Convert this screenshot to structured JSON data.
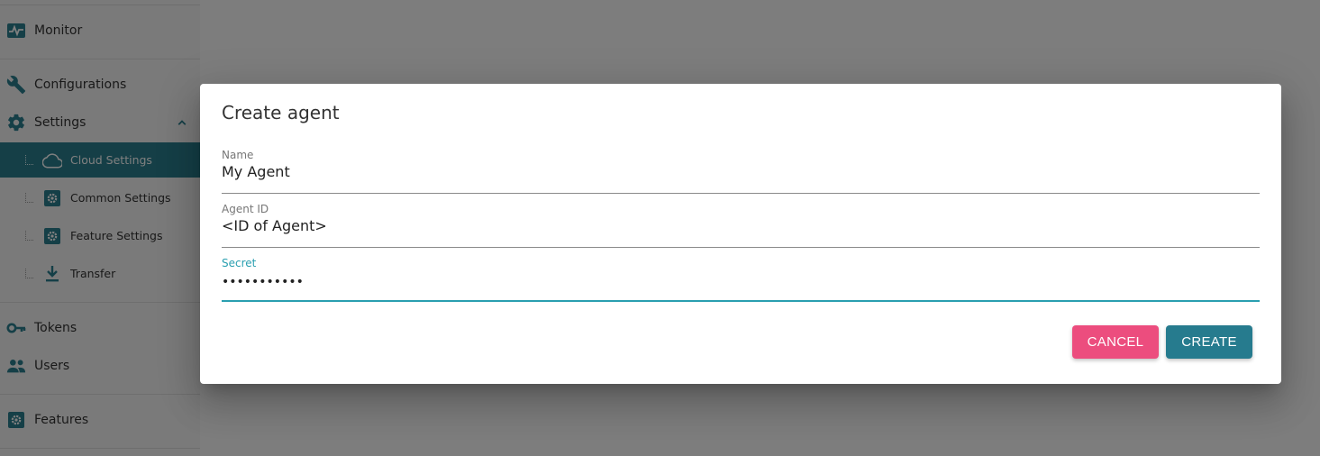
{
  "sidebar": {
    "items": [
      {
        "label": "Monitor",
        "icon": "monitor-icon"
      },
      {
        "label": "Configurations",
        "icon": "wrench-icon"
      },
      {
        "label": "Settings",
        "icon": "gear-icon",
        "expanded": true
      },
      {
        "label": "Tokens",
        "icon": "key-icon"
      },
      {
        "label": "Users",
        "icon": "users-icon"
      },
      {
        "label": "Features",
        "icon": "gear-box-icon"
      }
    ],
    "settings_children": [
      {
        "label": "Cloud Settings",
        "icon": "cloud-icon",
        "active": true
      },
      {
        "label": "Common Settings",
        "icon": "gear-box-icon"
      },
      {
        "label": "Feature Settings",
        "icon": "gear-box-icon"
      },
      {
        "label": "Transfer",
        "icon": "download-icon"
      }
    ]
  },
  "dialog": {
    "title": "Create agent",
    "fields": {
      "name": {
        "label": "Name",
        "value": "My Agent"
      },
      "agent_id": {
        "label": "Agent ID",
        "value": "<ID of Agent>"
      },
      "secret": {
        "label": "Secret",
        "value": "•••••••••••"
      }
    },
    "cancel_label": "CANCEL",
    "create_label": "CREATE"
  },
  "colors": {
    "accent": "#2a7f8f",
    "focus": "#2a9fb0",
    "cancel": "#ec4d7e",
    "create": "#267b8e"
  }
}
